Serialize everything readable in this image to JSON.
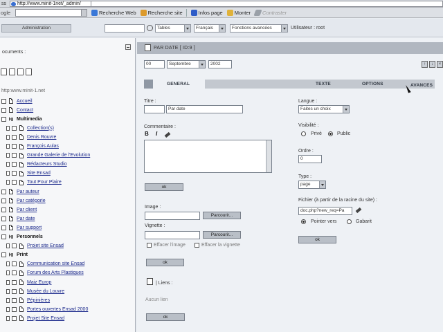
{
  "browser": {
    "address_label": "ss",
    "url": "http://www.minit-1net/_admin/",
    "google_label": "ogle"
  },
  "toolbar": {
    "web_search": "Recherche Web",
    "site_search": "Recherche site",
    "page_info": "Infos page",
    "up": "Monter",
    "highlight": "Contraster"
  },
  "admin_bar": {
    "admin_button": "Administration",
    "search_value": "",
    "table_select": "Tables",
    "language_select": "Français",
    "functions_select": "Fonctions avancées",
    "user_text": "Utilisateur : root"
  },
  "sidebar": {
    "title": "ocuments :",
    "root_url": "http:www.minit-1.net",
    "items": [
      {
        "label": "Accueil",
        "type": "doc",
        "level": 1
      },
      {
        "label": "Contact",
        "type": "doc",
        "level": 1
      },
      {
        "label": "Multimedia",
        "type": "folder",
        "level": 1
      },
      {
        "label": "Collection(s)",
        "type": "doc",
        "level": 2
      },
      {
        "label": "Denis Rouvre",
        "type": "doc",
        "level": 2
      },
      {
        "label": "François Aulas",
        "type": "doc",
        "level": 2
      },
      {
        "label": "Grande Galerie de l'Evolution",
        "type": "doc",
        "level": 2
      },
      {
        "label": "Rédacteurs Studio",
        "type": "doc",
        "level": 2
      },
      {
        "label": "Site Ensad",
        "type": "doc",
        "level": 2
      },
      {
        "label": "Tout Pour Plaire",
        "type": "doc",
        "level": 2
      },
      {
        "label": "Par auteur",
        "type": "doc",
        "level": 1
      },
      {
        "label": "Par catégorie",
        "type": "doc",
        "level": 1
      },
      {
        "label": "Par client",
        "type": "doc",
        "level": 1
      },
      {
        "label": "Par date",
        "type": "doc",
        "level": 1
      },
      {
        "label": "Par support",
        "type": "doc",
        "level": 1
      },
      {
        "label": "Personnels",
        "type": "folder",
        "level": 1
      },
      {
        "label": "Projet site Ensad",
        "type": "doc",
        "level": 2
      },
      {
        "label": "Print",
        "type": "folder",
        "level": 1
      },
      {
        "label": "Communication site Ensad",
        "type": "doc",
        "level": 2
      },
      {
        "label": "Forum des Arts Plastiques",
        "type": "doc",
        "level": 2
      },
      {
        "label": "Maiz Europ",
        "type": "doc",
        "level": 2
      },
      {
        "label": "Musée du Louvre",
        "type": "doc",
        "level": 2
      },
      {
        "label": "Pépinières",
        "type": "doc",
        "level": 2
      },
      {
        "label": "Portes ouvertes Ensad 2000",
        "type": "doc",
        "level": 2
      },
      {
        "label": "Projet Site Ensad",
        "type": "doc",
        "level": 2
      }
    ]
  },
  "main": {
    "header_title": "PAR DATE [ ID:9 ]",
    "date": {
      "day": "00",
      "month": "Septembre",
      "year": "2002"
    },
    "tabs": [
      "GENERAL",
      "TEXTE",
      "OPTIONS",
      "AVANCES"
    ],
    "title_label": "Titre :",
    "title_value": "Par date",
    "comment_label": "Commentaire :",
    "fmt_bold": "B",
    "fmt_italic": "I",
    "ok": "ok",
    "image_label": "Image :",
    "vignette_label": "Vignette :",
    "browse": "Parcourir...",
    "delete_image": "Effacer l'image",
    "delete_vignette": "Effacer la vignette",
    "links_label": "| Liens :",
    "no_link": "Aucun lien",
    "language_label": "Langue :",
    "language_value": "Faites un choix",
    "visibility_label": "Visibilité :",
    "private": "Privé",
    "public": "Public",
    "order_label": "Ordre :",
    "order_value": "0",
    "type_label": "Type :",
    "type_value": "page",
    "file_label": "Fichier (à partir de la racine du site) :",
    "file_value": "doc.php?new_req=Pa",
    "point_to": "Pointer vers",
    "save_option": "Gabarit"
  }
}
